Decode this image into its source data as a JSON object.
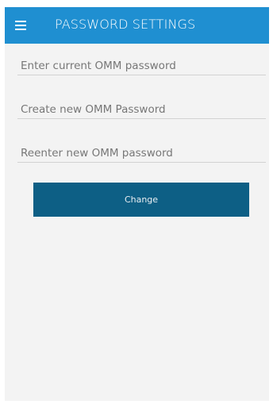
{
  "header": {
    "title": "PASSWORD SETTINGS",
    "menu_icon": "hamburger-menu-icon",
    "background_color": "#1f8fd1"
  },
  "form": {
    "current_password": {
      "placeholder": "Enter current OMM password",
      "value": ""
    },
    "new_password": {
      "placeholder": "Create new OMM Password",
      "value": ""
    },
    "reenter_password": {
      "placeholder": "Reenter new OMM password",
      "value": ""
    },
    "submit_label": "Change",
    "submit_color": "#0d5f85"
  }
}
